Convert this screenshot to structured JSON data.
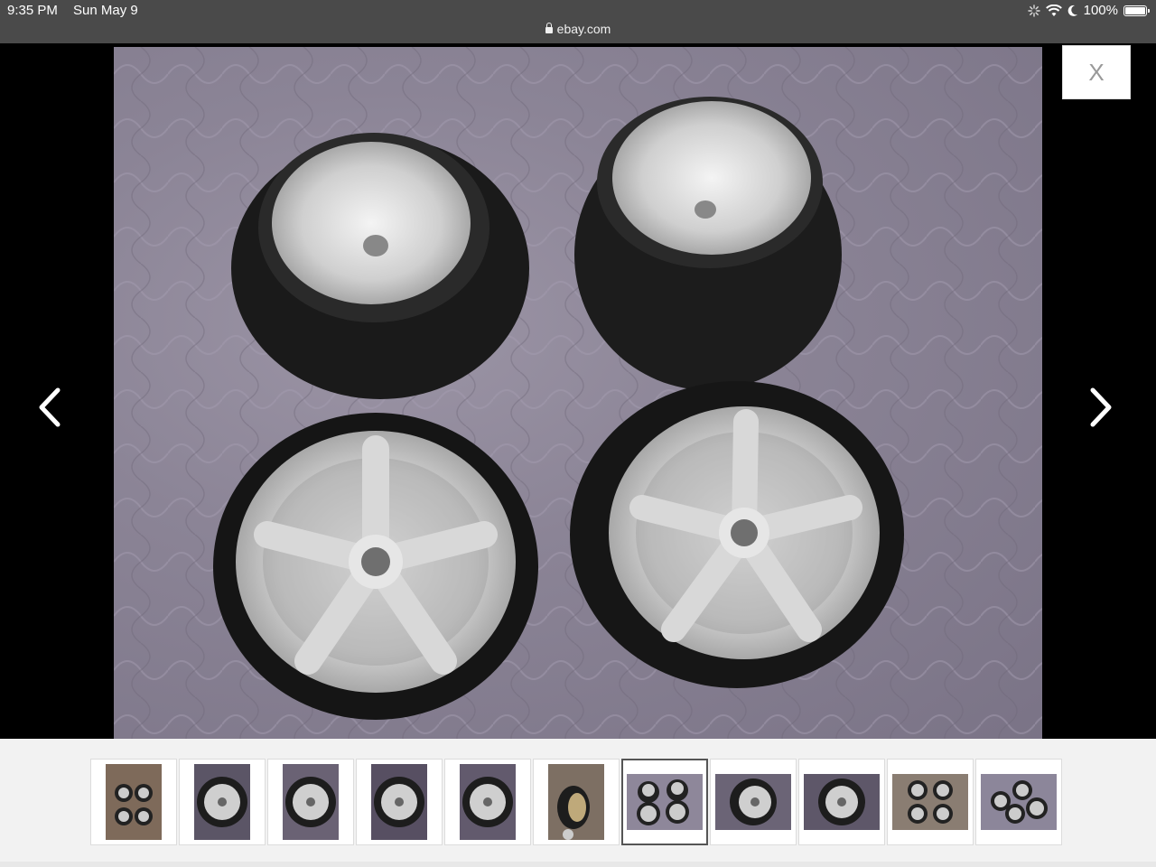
{
  "status": {
    "time": "9:35 PM",
    "date": "Sun May 9",
    "url": "ebay.com",
    "battery": "100%",
    "battery_level": 1.0
  },
  "viewer": {
    "close_label": "X",
    "prev_icon": "chevron-left-icon",
    "next_icon": "chevron-right-icon"
  },
  "thumbnails": {
    "count": 11,
    "selected_index": 6
  },
  "colors": {
    "status_bar": "#4a4a4a",
    "background": "#000000",
    "strip": "#f2f2f2"
  }
}
